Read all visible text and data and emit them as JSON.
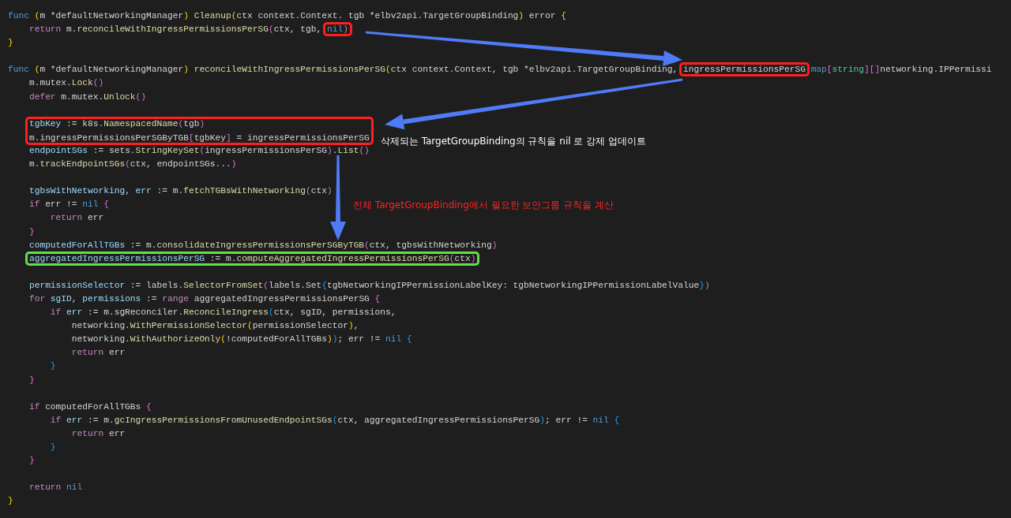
{
  "code": {
    "lines": [
      {
        "kind": "code",
        "tokens": [
          {
            "text": "func ",
            "kind": "storage"
          },
          {
            "text": "(",
            "kind": "bracket1"
          },
          {
            "text": "m *defaultNetworkingManager",
            "kind": "plain"
          },
          {
            "text": ") ",
            "kind": "bracket1"
          },
          {
            "text": "Cleanup",
            "kind": "function"
          },
          {
            "text": "(",
            "kind": "bracket1"
          },
          {
            "text": "ctx context.Context. tgb *elbv2api.TargetGroupBinding",
            "kind": "plain"
          },
          {
            "text": ")",
            "kind": "bracket1"
          },
          {
            "text": " error ",
            "kind": "plain"
          },
          {
            "text": "{",
            "kind": "bracket1"
          }
        ]
      },
      {
        "kind": "code",
        "tokens": [
          {
            "text": "    return",
            "kind": "keyword"
          },
          {
            "text": " m.",
            "kind": "plain"
          },
          {
            "text": "reconcileWithIngressPermissionsPerSG",
            "kind": "function"
          },
          {
            "text": "(",
            "kind": "bracket2"
          },
          {
            "text": "ctx, tgb, ",
            "kind": "plain"
          },
          {
            "kind": "frame",
            "color": "#ff1f1f",
            "tokens": [
              {
                "text": "nil",
                "kind": "storage"
              },
              {
                "text": ")",
                "kind": "bracket2"
              }
            ]
          }
        ]
      },
      {
        "kind": "code",
        "tokens": [
          {
            "text": "}",
            "kind": "bracket1"
          }
        ]
      },
      {
        "kind": "blank"
      },
      {
        "kind": "code",
        "tokens": [
          {
            "text": "func ",
            "kind": "storage"
          },
          {
            "text": "(",
            "kind": "bracket1"
          },
          {
            "text": "m *defaultNetworkingManager",
            "kind": "plain"
          },
          {
            "text": ") ",
            "kind": "bracket1"
          },
          {
            "text": "reconcileWithIngressPermissionsPerSG",
            "kind": "function"
          },
          {
            "text": "(",
            "kind": "bracket1"
          },
          {
            "text": "ctx context.Context, tgb *elbv2api.TargetGroupBinding, ",
            "kind": "plain"
          },
          {
            "kind": "frame",
            "color": "#ff1f1f",
            "tokens": [
              {
                "text": "ingressPermissionsPerSG",
                "kind": "plain"
              }
            ]
          },
          {
            "text": " map",
            "kind": "storage"
          },
          {
            "text": "[",
            "kind": "bracket2"
          },
          {
            "text": "string",
            "kind": "type"
          },
          {
            "text": "]",
            "kind": "bracket2"
          },
          {
            "text": "[]",
            "kind": "bracket2"
          },
          {
            "text": "networking.IPPermissi",
            "kind": "plain"
          }
        ]
      },
      {
        "kind": "code",
        "tokens": [
          {
            "text": "    m.mutex.",
            "kind": "plain"
          },
          {
            "text": "Lock",
            "kind": "function"
          },
          {
            "text": "()",
            "kind": "bracket2"
          }
        ]
      },
      {
        "kind": "code",
        "tokens": [
          {
            "text": "    defer",
            "kind": "keyword"
          },
          {
            "text": " m.mutex.",
            "kind": "plain"
          },
          {
            "text": "Unlock",
            "kind": "function"
          },
          {
            "text": "()",
            "kind": "bracket2"
          }
        ]
      },
      {
        "kind": "blank"
      },
      {
        "kind": "frame",
        "color": "#ff1f1f",
        "lines": [
          {
            "kind": "code",
            "tokens": [
              {
                "text": "    tgbKey",
                "kind": "variable"
              },
              {
                "text": " := k8s.",
                "kind": "plain"
              },
              {
                "text": "NamespacedName",
                "kind": "function"
              },
              {
                "text": "(",
                "kind": "bracket2"
              },
              {
                "text": "tgb",
                "kind": "plain"
              },
              {
                "text": ")",
                "kind": "bracket2"
              }
            ]
          },
          {
            "kind": "code",
            "tokens": [
              {
                "text": "    m.ingressPermissionsPerSGByTGB",
                "kind": "plain"
              },
              {
                "text": "[",
                "kind": "bracket2"
              },
              {
                "text": "tgbKey",
                "kind": "plain"
              },
              {
                "text": "]",
                "kind": "bracket2"
              },
              {
                "text": " = ingressPermissionsPerSG",
                "kind": "plain"
              }
            ],
            "note": {
              "text": "삭제되는 TargetGroupBinding의 규칙을 nil 로 강제 업데이트",
              "color": "#ffffff"
            }
          }
        ]
      },
      {
        "kind": "code",
        "tokens": [
          {
            "text": "    endpointSGs",
            "kind": "variable"
          },
          {
            "text": " := sets.",
            "kind": "plain"
          },
          {
            "text": "StringKeySet",
            "kind": "function"
          },
          {
            "text": "(",
            "kind": "bracket2"
          },
          {
            "text": "ingressPermissionsPerSG",
            "kind": "plain"
          },
          {
            "text": ")",
            "kind": "bracket2"
          },
          {
            "text": ".",
            "kind": "plain"
          },
          {
            "text": "List",
            "kind": "function"
          },
          {
            "text": "()",
            "kind": "bracket2"
          }
        ]
      },
      {
        "kind": "code",
        "tokens": [
          {
            "text": "    m.",
            "kind": "plain"
          },
          {
            "text": "trackEndpointSGs",
            "kind": "function"
          },
          {
            "text": "(",
            "kind": "bracket2"
          },
          {
            "text": "ctx, endpointSGs...",
            "kind": "plain"
          },
          {
            "text": ")",
            "kind": "bracket2"
          }
        ]
      },
      {
        "kind": "blank"
      },
      {
        "kind": "code",
        "tokens": [
          {
            "text": "    tgbsWithNetworking",
            "kind": "variable"
          },
          {
            "text": ", ",
            "kind": "plain"
          },
          {
            "text": "err",
            "kind": "variable"
          },
          {
            "text": " := m.",
            "kind": "plain"
          },
          {
            "text": "fetchTGBsWithNetworking",
            "kind": "function"
          },
          {
            "text": "(",
            "kind": "bracket2"
          },
          {
            "text": "ctx",
            "kind": "plain"
          },
          {
            "text": ")",
            "kind": "bracket2"
          }
        ]
      },
      {
        "kind": "code",
        "tokens": [
          {
            "text": "    if",
            "kind": "keyword"
          },
          {
            "text": " err != ",
            "kind": "plain"
          },
          {
            "text": "nil ",
            "kind": "storage"
          },
          {
            "text": "{",
            "kind": "bracket2"
          }
        ],
        "note": {
          "text": "전체 TargetGroupBinding에서 필요한 보안그룹 규칙을 계산",
          "color": "#ff2424"
        }
      },
      {
        "kind": "code",
        "tokens": [
          {
            "text": "        return",
            "kind": "keyword"
          },
          {
            "text": " err",
            "kind": "plain"
          }
        ]
      },
      {
        "kind": "code",
        "tokens": [
          {
            "text": "    }",
            "kind": "bracket2"
          }
        ]
      },
      {
        "kind": "code",
        "tokens": [
          {
            "text": "    computedForAllTGBs",
            "kind": "variable"
          },
          {
            "text": " := m.",
            "kind": "plain"
          },
          {
            "text": "consolidateIngressPermissionsPerSGByTGB",
            "kind": "function"
          },
          {
            "text": "(",
            "kind": "bracket2"
          },
          {
            "text": "ctx, tgbsWithNetworking",
            "kind": "plain"
          },
          {
            "text": ")",
            "kind": "bracket2"
          }
        ]
      },
      {
        "kind": "frame",
        "color": "#63e046",
        "lines": [
          {
            "kind": "code",
            "tokens": [
              {
                "text": "    aggregatedIngressPermissionsPerSG",
                "kind": "variable"
              },
              {
                "text": " := m.",
                "kind": "plain"
              },
              {
                "text": "computeAggregatedIngressPermissionsPerSG",
                "kind": "function"
              },
              {
                "text": "(",
                "kind": "bracket2"
              },
              {
                "text": "ctx",
                "kind": "plain"
              },
              {
                "text": ")",
                "kind": "bracket2"
              }
            ]
          }
        ]
      },
      {
        "kind": "blank"
      },
      {
        "kind": "code",
        "tokens": [
          {
            "text": "    permissionSelector",
            "kind": "variable"
          },
          {
            "text": " := labels.",
            "kind": "plain"
          },
          {
            "text": "SelectorFromSet",
            "kind": "function"
          },
          {
            "text": "(",
            "kind": "bracket2"
          },
          {
            "text": "labels.Set",
            "kind": "plain"
          },
          {
            "text": "{",
            "kind": "bracket3"
          },
          {
            "text": "tgbNetworkingIPPermissionLabelKey: tgbNetworkingIPPermissionLabelValue",
            "kind": "plain"
          },
          {
            "text": "}",
            "kind": "bracket3"
          },
          {
            "text": ")",
            "kind": "bracket2"
          }
        ]
      },
      {
        "kind": "code",
        "tokens": [
          {
            "text": "    for",
            "kind": "keyword"
          },
          {
            "text": " sgID",
            "kind": "variable"
          },
          {
            "text": ", ",
            "kind": "plain"
          },
          {
            "text": "permissions",
            "kind": "variable"
          },
          {
            "text": " := ",
            "kind": "plain"
          },
          {
            "text": "range",
            "kind": "keyword"
          },
          {
            "text": " aggregatedIngressPermissionsPerSG ",
            "kind": "plain"
          },
          {
            "text": "{",
            "kind": "bracket2"
          }
        ]
      },
      {
        "kind": "code",
        "tokens": [
          {
            "text": "        if",
            "kind": "keyword"
          },
          {
            "text": " err",
            "kind": "variable"
          },
          {
            "text": " := m.sgReconciler.",
            "kind": "plain"
          },
          {
            "text": "ReconcileIngress",
            "kind": "function"
          },
          {
            "text": "(",
            "kind": "bracket3"
          },
          {
            "text": "ctx, sgID, permissions,",
            "kind": "plain"
          }
        ]
      },
      {
        "kind": "code",
        "tokens": [
          {
            "text": "            networking.",
            "kind": "plain"
          },
          {
            "text": "WithPermissionSelector",
            "kind": "function"
          },
          {
            "text": "(",
            "kind": "bracket1"
          },
          {
            "text": "permissionSelector",
            "kind": "plain"
          },
          {
            "text": ")",
            "kind": "bracket1"
          },
          {
            "text": ",",
            "kind": "plain"
          }
        ]
      },
      {
        "kind": "code",
        "tokens": [
          {
            "text": "            networking.",
            "kind": "plain"
          },
          {
            "text": "WithAuthorizeOnly",
            "kind": "function"
          },
          {
            "text": "(",
            "kind": "bracket1"
          },
          {
            "text": "!computedForAllTGBs",
            "kind": "plain"
          },
          {
            "text": ")",
            "kind": "bracket1"
          },
          {
            "text": ")",
            "kind": "bracket3"
          },
          {
            "text": "; err != ",
            "kind": "plain"
          },
          {
            "text": "nil ",
            "kind": "storage"
          },
          {
            "text": "{",
            "kind": "bracket3"
          }
        ]
      },
      {
        "kind": "code",
        "tokens": [
          {
            "text": "            return",
            "kind": "keyword"
          },
          {
            "text": " err",
            "kind": "plain"
          }
        ]
      },
      {
        "kind": "code",
        "tokens": [
          {
            "text": "        }",
            "kind": "bracket3"
          }
        ]
      },
      {
        "kind": "code",
        "tokens": [
          {
            "text": "    }",
            "kind": "bracket2"
          }
        ]
      },
      {
        "kind": "blank"
      },
      {
        "kind": "code",
        "tokens": [
          {
            "text": "    if",
            "kind": "keyword"
          },
          {
            "text": " computedForAllTGBs ",
            "kind": "plain"
          },
          {
            "text": "{",
            "kind": "bracket2"
          }
        ]
      },
      {
        "kind": "code",
        "tokens": [
          {
            "text": "        if",
            "kind": "keyword"
          },
          {
            "text": " err",
            "kind": "variable"
          },
          {
            "text": " := m.",
            "kind": "plain"
          },
          {
            "text": "gcIngressPermissionsFromUnusedEndpointSGs",
            "kind": "function"
          },
          {
            "text": "(",
            "kind": "bracket3"
          },
          {
            "text": "ctx, aggregatedIngressPermissionsPerSG",
            "kind": "plain"
          },
          {
            "text": ")",
            "kind": "bracket3"
          },
          {
            "text": "; err != ",
            "kind": "plain"
          },
          {
            "text": "nil ",
            "kind": "storage"
          },
          {
            "text": "{",
            "kind": "bracket3"
          }
        ]
      },
      {
        "kind": "code",
        "tokens": [
          {
            "text": "            return",
            "kind": "keyword"
          },
          {
            "text": " err",
            "kind": "plain"
          }
        ]
      },
      {
        "kind": "code",
        "tokens": [
          {
            "text": "        }",
            "kind": "bracket3"
          }
        ]
      },
      {
        "kind": "code",
        "tokens": [
          {
            "text": "    }",
            "kind": "bracket2"
          }
        ]
      },
      {
        "kind": "blank"
      },
      {
        "kind": "code",
        "tokens": [
          {
            "text": "    return",
            "kind": "keyword"
          },
          {
            "text": " nil",
            "kind": "storage"
          }
        ]
      },
      {
        "kind": "code",
        "tokens": [
          {
            "text": "}",
            "kind": "bracket1"
          }
        ]
      }
    ]
  }
}
